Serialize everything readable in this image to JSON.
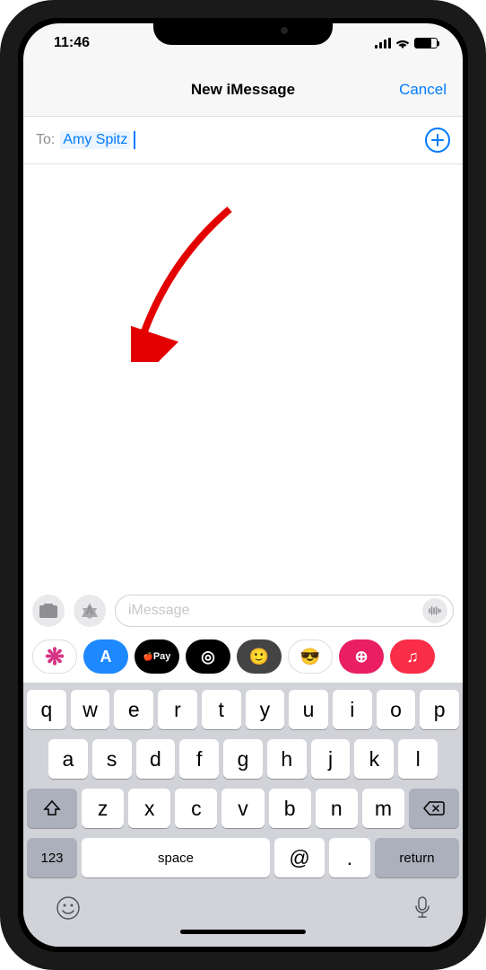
{
  "status": {
    "time": "11:46"
  },
  "nav": {
    "title": "New iMessage",
    "cancel": "Cancel"
  },
  "to_field": {
    "label": "To:",
    "recipient": "Amy Spitz"
  },
  "message_input": {
    "placeholder": "iMessage"
  },
  "app_drawer": [
    {
      "name": "photos",
      "bg": "linear-gradient(#fff,#fff)",
      "content": "❋"
    },
    {
      "name": "app-store",
      "bg": "#1e88ff",
      "content": "A"
    },
    {
      "name": "apple-pay",
      "bg": "#000",
      "content": "Pay"
    },
    {
      "name": "activity",
      "bg": "#000",
      "content": "◎"
    },
    {
      "name": "animoji",
      "bg": "#444",
      "content": "🙂"
    },
    {
      "name": "memoji",
      "bg": "#fff",
      "content": "😎"
    },
    {
      "name": "hearts",
      "bg": "#e91e63",
      "content": "⊕"
    },
    {
      "name": "music",
      "bg": "linear-gradient(#fa2d48,#fa2d48)",
      "content": "♫"
    }
  ],
  "keyboard": {
    "row1": [
      "q",
      "w",
      "e",
      "r",
      "t",
      "y",
      "u",
      "i",
      "o",
      "p"
    ],
    "row2": [
      "a",
      "s",
      "d",
      "f",
      "g",
      "h",
      "j",
      "k",
      "l"
    ],
    "row3": [
      "z",
      "x",
      "c",
      "v",
      "b",
      "n",
      "m"
    ],
    "num_key": "123",
    "space_key": "space",
    "at_key": "@",
    "dot_key": ".",
    "return_key": "return"
  }
}
